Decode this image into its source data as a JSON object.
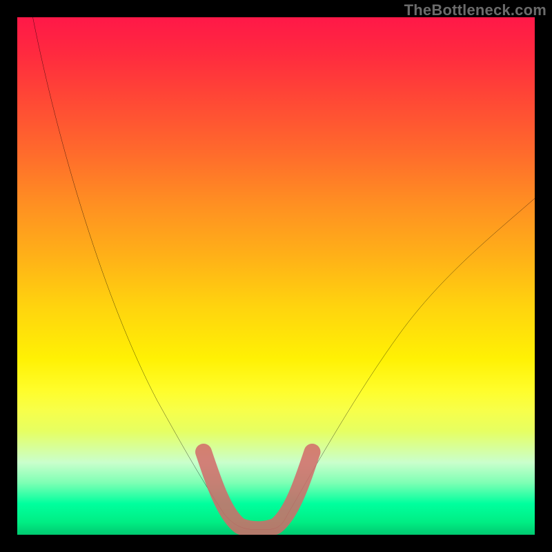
{
  "watermark": {
    "text": "TheBottleneck.com"
  },
  "chart_data": {
    "type": "line",
    "title": "",
    "xlabel": "",
    "ylabel": "",
    "xlim": [
      0,
      100
    ],
    "ylim": [
      0,
      100
    ],
    "series": [
      {
        "name": "left-curve",
        "x": [
          3,
          6,
          9,
          12,
          15,
          18,
          21,
          24,
          27,
          30,
          33,
          36,
          38,
          40
        ],
        "values": [
          100,
          92,
          84,
          76,
          68,
          60,
          52,
          44,
          36,
          28,
          20,
          12,
          6,
          2
        ]
      },
      {
        "name": "bottom-valley",
        "x": [
          40,
          44,
          48,
          52
        ],
        "values": [
          2,
          0.5,
          0.5,
          2
        ]
      },
      {
        "name": "right-curve",
        "x": [
          52,
          56,
          60,
          64,
          68,
          72,
          76,
          80,
          84,
          88,
          92,
          96,
          100
        ],
        "values": [
          2,
          8,
          14,
          20,
          26,
          32,
          37,
          42,
          47,
          52,
          57,
          61,
          65
        ]
      }
    ],
    "highlight": {
      "description": "bottom-of-valley overlay segment",
      "color": "#d26a68",
      "x": [
        36,
        38,
        40,
        43,
        46,
        49,
        52,
        54,
        56
      ],
      "values": [
        17,
        10,
        4,
        1.5,
        1.2,
        1.5,
        4,
        10,
        17
      ]
    },
    "background": {
      "type": "vertical-gradient",
      "stops": [
        {
          "pos": 0,
          "color": "#ff1848"
        },
        {
          "pos": 36,
          "color": "#ff8f22"
        },
        {
          "pos": 66,
          "color": "#fff104"
        },
        {
          "pos": 94,
          "color": "#00ff9e"
        },
        {
          "pos": 100,
          "color": "#00ca70"
        }
      ]
    }
  }
}
